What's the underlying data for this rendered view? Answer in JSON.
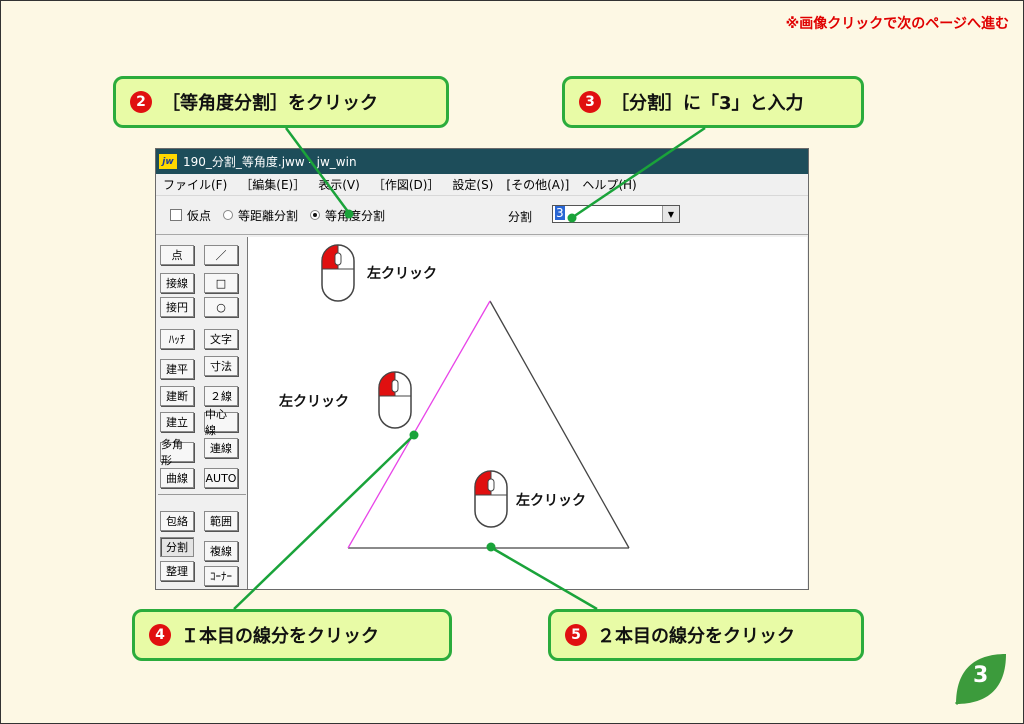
{
  "nav_hint": "※画像クリックで次のページへ進む",
  "callouts": {
    "step2": {
      "num": "2",
      "text": "［等角度分割］をクリック"
    },
    "step3": {
      "num": "3",
      "text": "［分割］に「3」と入力"
    },
    "step4": {
      "num": "4",
      "text": "Ｉ本目の線分をクリック"
    },
    "step5": {
      "num": "5",
      "text": "２本目の線分をクリック"
    }
  },
  "window": {
    "title": "190_分割_等角度.jww - jw_win",
    "icon_text": "jw",
    "menu": [
      "ファイル(F)",
      "［編集(E)］",
      "表示(V)",
      "［作図(D)］",
      "設定(S)",
      "[その他(A)]",
      "ヘルプ(H)"
    ],
    "toolbar": {
      "kari_label": "仮点",
      "equal_distance_label": "等距離分割",
      "equal_angle_label": "等角度分割",
      "division_label": "分割",
      "division_value": "3"
    },
    "tools_left": [
      "点",
      "接線",
      "接円",
      "ﾊｯﾁ",
      "建平",
      "建断",
      "建立",
      "多角形",
      "曲線",
      "包絡",
      "分割",
      "整理"
    ],
    "tools_right": [
      "／",
      "□",
      "○",
      "文字",
      "寸法",
      "２線",
      "中心線",
      "連線",
      "AUTO",
      "範囲",
      "複線",
      "ｺｰﾅｰ"
    ]
  },
  "clicks": [
    "左クリック",
    "左クリック",
    "左クリック"
  ],
  "colors": {
    "callout_bg": "#e8fba6",
    "callout_border": "#2bac3c",
    "accent_red": "#e00000",
    "titlebar": "#1d4d5a",
    "selected_line": "#e844e8"
  },
  "page_number": "3"
}
